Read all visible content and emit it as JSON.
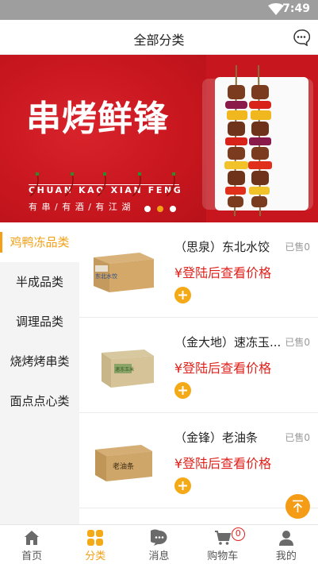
{
  "status_bar": {
    "time": "7:49"
  },
  "header": {
    "title": "全部分类",
    "message_icon": "chat-bubble-icon"
  },
  "banner": {
    "brand": "串烤鲜锋",
    "pinyin": "CHUAN KAO XIAN FENG",
    "slogan": "有 串 / 有 酒 / 有 江 湖",
    "pager": {
      "count": 3,
      "active_index": 1
    },
    "colors": {
      "background": "#c8161e"
    }
  },
  "sidebar": {
    "items": [
      {
        "label": "鸡鸭冻品类",
        "active": true
      },
      {
        "label": "半成品类",
        "active": false
      },
      {
        "label": "调理品类",
        "active": false
      },
      {
        "label": "烧烤烤串类",
        "active": false
      },
      {
        "label": "面点点心类",
        "active": false
      }
    ]
  },
  "products": [
    {
      "name": "（思泉）东北水饺",
      "price": "¥登陆后查看价格",
      "sold": "已售0",
      "box_label": "东北水饺"
    },
    {
      "name": "（金大地）速冻玉...",
      "price": "¥登陆后查看价格",
      "sold": "已售0",
      "box_label": "速冻玉米"
    },
    {
      "name": "（金锋）老油条",
      "price": "¥登陆后查看价格",
      "sold": "已售0",
      "box_label": "老油条"
    }
  ],
  "tabbar": {
    "tabs": [
      {
        "label": "首页",
        "icon": "home-icon",
        "active": false
      },
      {
        "label": "分类",
        "icon": "grid-icon",
        "active": true
      },
      {
        "label": "消息",
        "icon": "message-icon",
        "active": false
      },
      {
        "label": "购物车",
        "icon": "cart-icon",
        "active": false,
        "badge": "0"
      },
      {
        "label": "我的",
        "icon": "user-icon",
        "active": false
      }
    ]
  },
  "colors": {
    "accent": "#f4a016",
    "price": "#e0211b",
    "status_bar": "#9e9e9e"
  }
}
